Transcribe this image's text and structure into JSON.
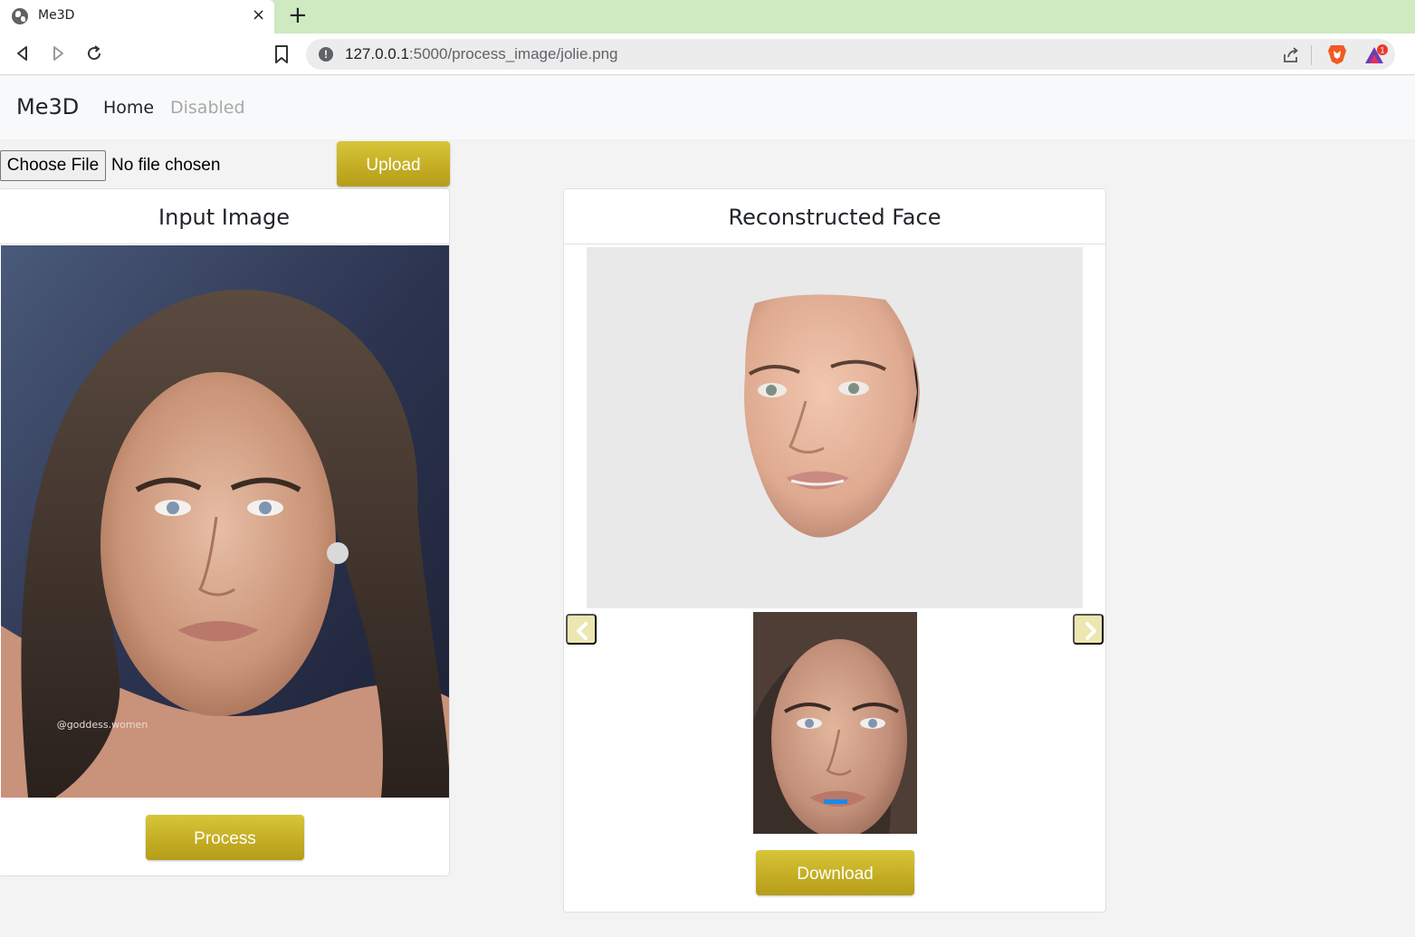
{
  "browser": {
    "tab_title": "Me3D",
    "tab_close": "×",
    "new_tab": "+",
    "url_host": "127.0.0.1",
    "url_rest": ":5000/process_image/jolie.png",
    "rewards_badge": "1"
  },
  "navbar": {
    "brand": "Me3D",
    "links": [
      {
        "label": "Home",
        "state": "active"
      },
      {
        "label": "Disabled",
        "state": "disabled"
      }
    ]
  },
  "upload_form": {
    "choose_file_label": "Choose File",
    "file_status": "No file chosen",
    "upload_label": "Upload"
  },
  "input_card": {
    "title": "Input Image",
    "process_label": "Process"
  },
  "reconstructed_card": {
    "title": "Reconstructed Face",
    "download_label": "Download"
  },
  "colors": {
    "button_gold": "#c3ac23",
    "tab_strip": "#cdeac0",
    "carousel_indicator": "#1b8ae6"
  }
}
